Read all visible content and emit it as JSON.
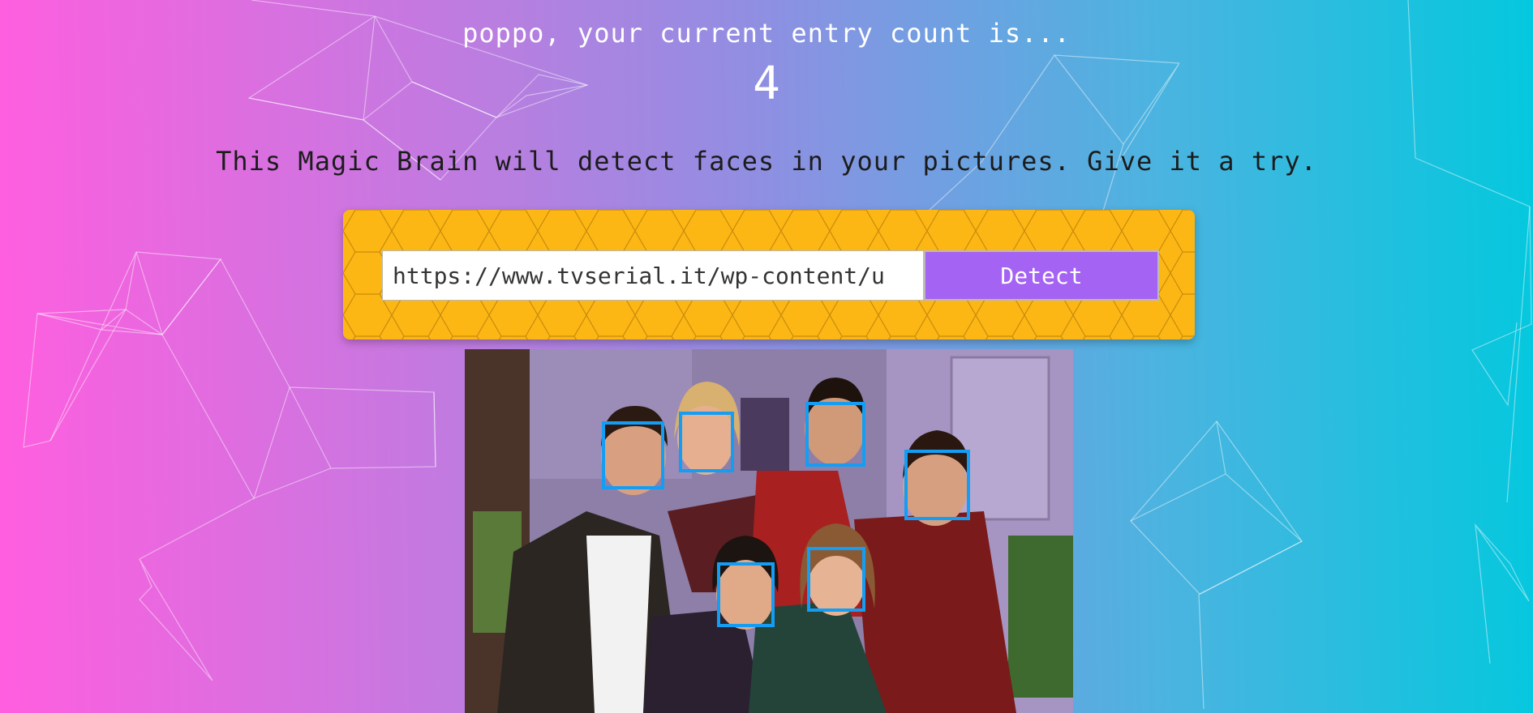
{
  "user": {
    "name": "poppo",
    "greeting": "poppo, your current entry count is...",
    "entry_count": "4"
  },
  "tagline": "This Magic Brain will detect faces in your pictures. Give it a try.",
  "form": {
    "url_value": "https://www.tvserial.it/wp-content/u",
    "detect_label": "Detect"
  },
  "colors": {
    "gradient_left": "#ff5edf",
    "gradient_right": "#04c8de",
    "panel": "#fcb715",
    "button": "#a463f2",
    "face_box": "#149df2"
  },
  "detected_faces_count": 6
}
